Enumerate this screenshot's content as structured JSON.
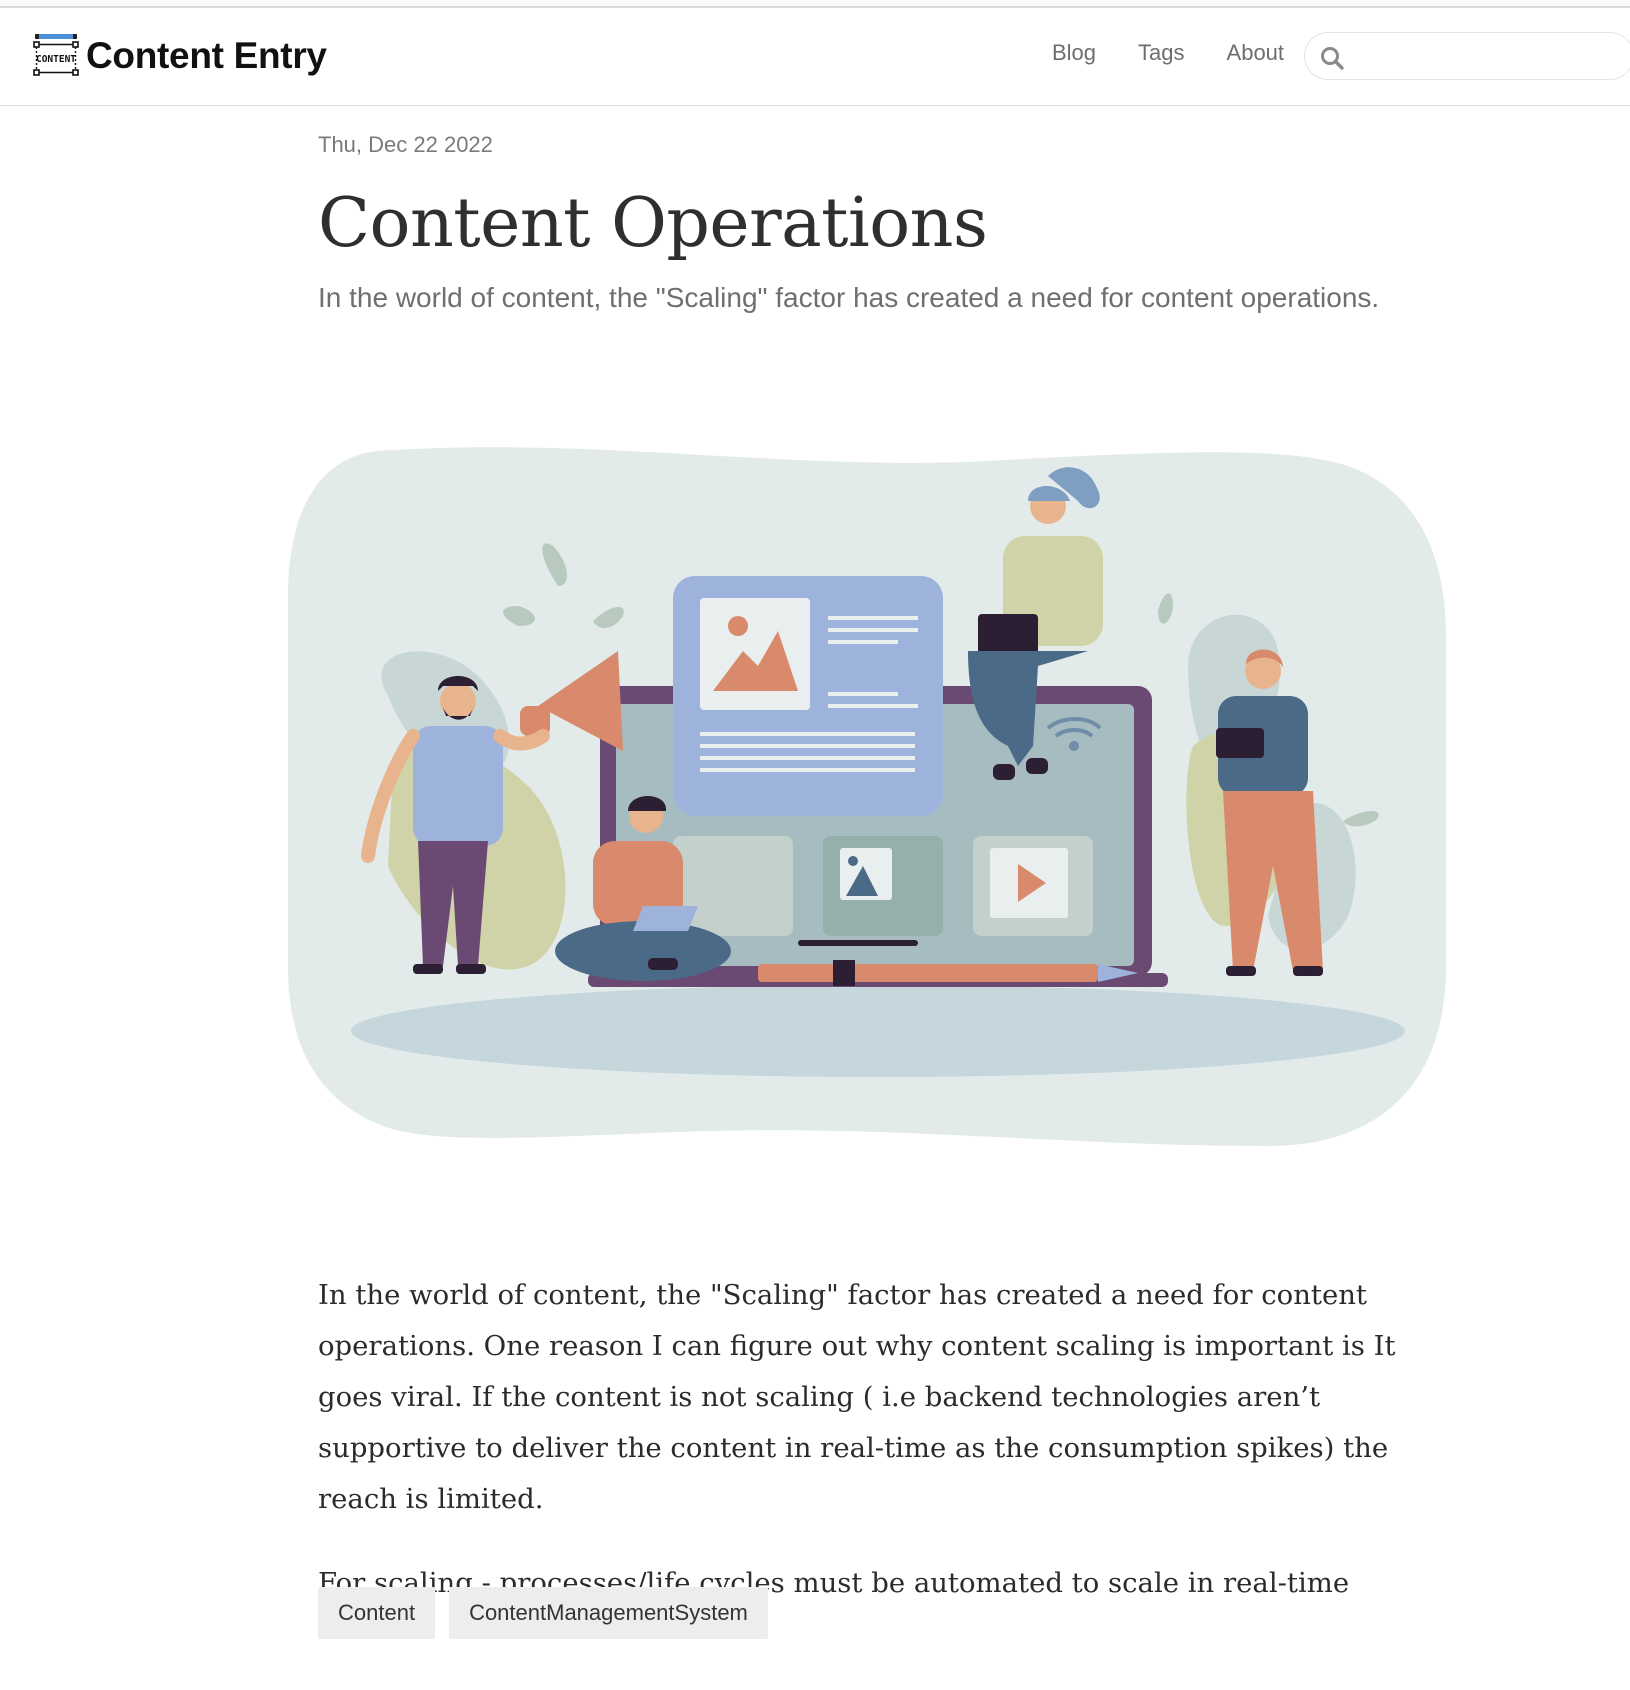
{
  "header": {
    "brand_name": "Content Entry",
    "logo_text": "CONTENT",
    "nav": [
      {
        "label": "Blog"
      },
      {
        "label": "Tags"
      },
      {
        "label": "About"
      }
    ],
    "search": {
      "value": "",
      "icon": "search-icon"
    }
  },
  "post": {
    "date": "Thu, Dec 22 2022",
    "title": "Content Operations",
    "subtitle": "In the world of content, the \"Scaling\" factor has created a need for content operations.",
    "paragraphs": [
      "In the world of content, the \"Scaling\" factor has created a need for content operations. One reason I can figure out why content scaling is important is It goes viral. If the content is not scaling ( i.e backend technologies aren’t supportive to deliver the content in real-time as the consumption spikes) the reach is limited.",
      "For scaling - processes/life cycles must be automated to scale in real-time"
    ],
    "tags": [
      "Content",
      "ContentManagementSystem"
    ]
  },
  "colors": {
    "hero_background": "#e2ebe9",
    "purple": "#6a4a73",
    "salmon": "#d98a6c",
    "blue_card": "#9db3db",
    "navy": "#4b6a88",
    "olive": "#cfd3a7"
  }
}
